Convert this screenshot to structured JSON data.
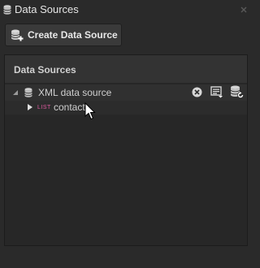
{
  "window": {
    "title": "Data Sources",
    "icons": {
      "title": "database-icon",
      "close": "close-icon"
    }
  },
  "toolbar": {
    "create_label": "Create Data Source",
    "create_icon": "add-database-icon"
  },
  "panel": {
    "title": "Data Sources",
    "tree": [
      {
        "label": "XML data source",
        "icon": "database-icon",
        "expanded": true,
        "actions": [
          "remove-icon",
          "edit-source-icon",
          "refresh-database-icon"
        ],
        "children": [
          {
            "badge": "LIST",
            "label": "contact",
            "expanded": false
          }
        ]
      }
    ]
  },
  "colors": {
    "background": "#2a2a2a",
    "panel": "#272727",
    "header": "#333333",
    "selected_row": "#303030",
    "list_badge": "#e05aa0",
    "text": "#cfcfcf"
  }
}
